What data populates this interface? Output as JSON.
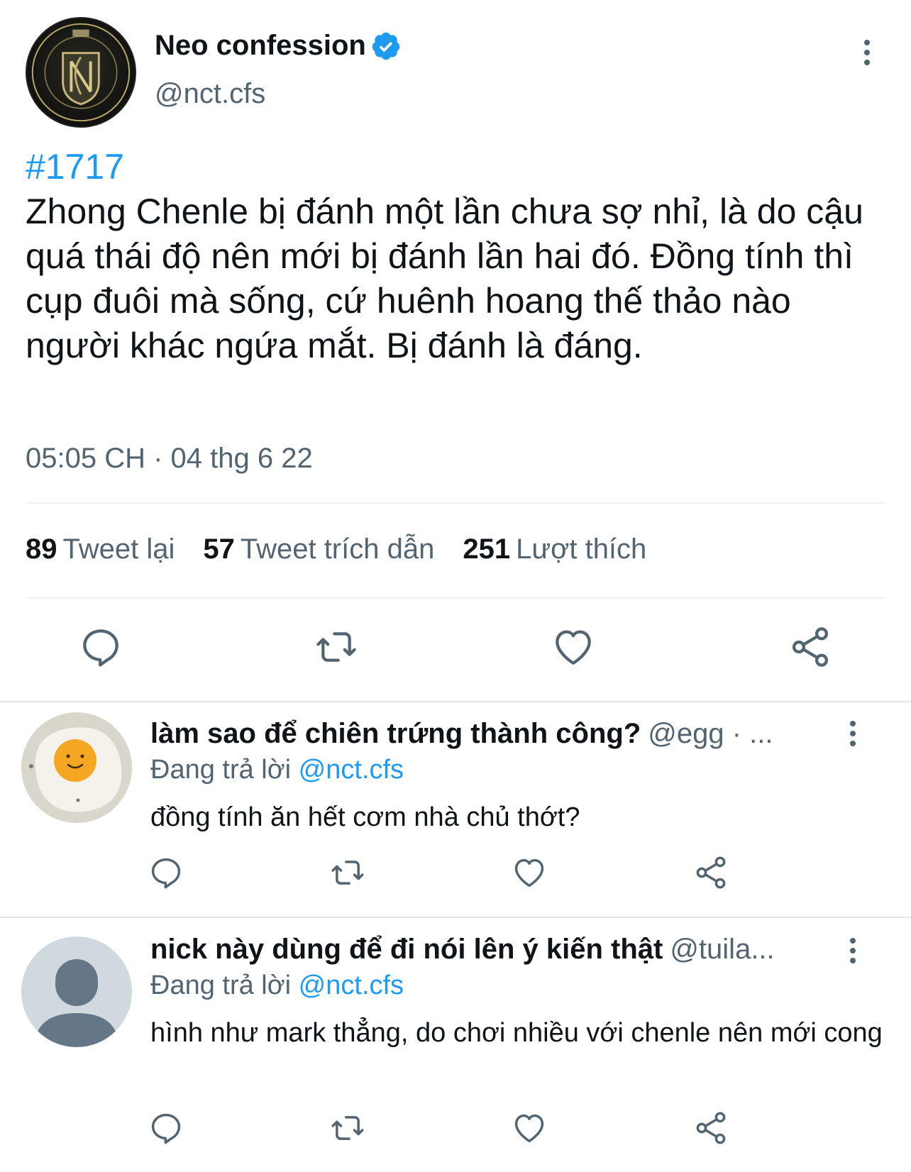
{
  "tweet": {
    "display_name": "Neo confession",
    "handle": "@nct.cfs",
    "hashtag": "#1717",
    "text": "Zhong Chenle bị đánh một lần chưa sợ nhỉ, là do cậu quá thái độ nên mới bị đánh lần hai đó. Đồng tính thì cụp đuôi mà sống, cứ huênh hoang thế thảo nào người khác ngứa mắt. Bị đánh là đáng.",
    "timestamp": "05:05 CH · 04 thg 6 22",
    "stats": {
      "retweets_count": "89",
      "retweets_label": "Tweet lại",
      "quotes_count": "57",
      "quotes_label": "Tweet trích dẫn",
      "likes_count": "251",
      "likes_label": "Lượt thích"
    },
    "accent_color": "#1d9bf0"
  },
  "replies": [
    {
      "display_name": "làm sao để chiên trứng thành công?",
      "handle": "@egg · ...",
      "replying_label": "Đang trả lời",
      "replying_to": "@nct.cfs",
      "text": "đồng tính ăn hết cơm nhà chủ thớt?",
      "avatar": "fried-egg"
    },
    {
      "display_name": "nick này dùng để đi nói lên ý kiến thật",
      "handle": "@tuila...",
      "replying_label": "Đang trả lời",
      "replying_to": "@nct.cfs",
      "text": "hình như mark thẳng, do chơi nhiều với chenle nên mới cong",
      "avatar": "default-person"
    }
  ]
}
